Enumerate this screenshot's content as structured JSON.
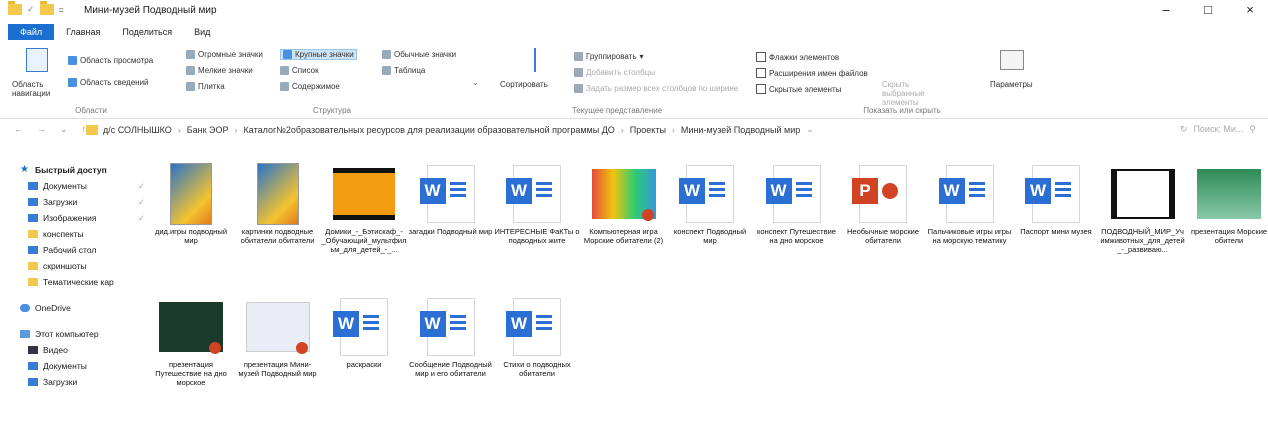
{
  "title": "Мини-музей Подводный мир",
  "window_controls": [
    "–",
    "□",
    "×"
  ],
  "tabs": [
    "Файл",
    "Главная",
    "Поделиться",
    "Вид"
  ],
  "ribbon": {
    "panes": {
      "nav_area": "Область навигации",
      "preview": "Область просмотра",
      "details": "Область сведений",
      "label": "Области"
    },
    "layout": {
      "huge": "Огромные значки",
      "large": "Крупные значки",
      "normal": "Обычные значки",
      "small": "Мелкие значки",
      "list": "Список",
      "table": "Таблица",
      "tiles": "Плитка",
      "content": "Содержимое",
      "label": "Структура"
    },
    "view": {
      "sort": "Сортировать",
      "group": "Группировать",
      "add_columns": "Добавить столбцы",
      "fit_columns": "Задать размер всех столбцов по ширине",
      "label": "Текущее представление"
    },
    "show": {
      "checkboxes": "Флажки элементов",
      "extensions": "Расширения имен файлов",
      "hidden": "Скрытые элементы",
      "hide_selected": "Скрыть выбранные элементы",
      "options": "Параметры",
      "label": "Показать или скрыть"
    }
  },
  "breadcrumbs": [
    "д/с СОЛНЫШКО",
    "Банк ЭОР",
    "Каталог№2образовательных ресурсов для реализации образовательной программы ДО",
    "Проекты",
    "Мини-музей Подводный мир"
  ],
  "search_placeholder": "Поиск: Ми...",
  "sidebar": [
    {
      "label": "Быстрый доступ",
      "icon": "star-icon"
    },
    {
      "label": "Документы",
      "icon": "documents-icon"
    },
    {
      "label": "Загрузки",
      "icon": "downloads-icon"
    },
    {
      "label": "Изображения",
      "icon": "pictures-icon"
    },
    {
      "label": "конспекты",
      "icon": "folder-icon"
    },
    {
      "label": "Рабочий стол",
      "icon": "desktop-icon"
    },
    {
      "label": "скриншоты",
      "icon": "folder-icon"
    },
    {
      "label": "Тематические кар",
      "icon": "folder-icon"
    },
    {
      "label": "OneDrive",
      "icon": "cloud-icon"
    },
    {
      "label": "Этот компьютер",
      "icon": "computer-icon"
    },
    {
      "label": "Видео",
      "icon": "video-folder-icon"
    },
    {
      "label": "Документы",
      "icon": "documents-icon"
    },
    {
      "label": "Загрузки",
      "icon": "downloads-icon"
    }
  ],
  "files": [
    {
      "name": "дид.игры подводный мир",
      "type": "folder-img"
    },
    {
      "name": "картинки подводные обитатели обитатели",
      "type": "folder-img"
    },
    {
      "name": "Домики_-_Бэтискаф_-_Обучающий_мультфильм_для_детей_-_...",
      "type": "video"
    },
    {
      "name": "загадки Подводный мир",
      "type": "word"
    },
    {
      "name": "ИНТЕРЕСНЫЕ ФаКТы о подводных жите",
      "type": "word"
    },
    {
      "name": "Компьютерная игра Морские обитатели (2)",
      "type": "pres1"
    },
    {
      "name": "конспект Подводный мир",
      "type": "word"
    },
    {
      "name": "конспект Путешествие на дно морское",
      "type": "word"
    },
    {
      "name": "Необычные морские обитатели",
      "type": "ppt"
    },
    {
      "name": "Пальчиковые игры игры на морскую тематику",
      "type": "word"
    },
    {
      "name": "Паспорт мини музея",
      "type": "word"
    },
    {
      "name": "ПОДВОДНЫЙ_МИР_Учимживотных_для_детей_-_развиваю...",
      "type": "video2"
    },
    {
      "name": "презентация Морские обители",
      "type": "pres3"
    },
    {
      "name": "презентация Путешествие на дно морское",
      "type": "pres2"
    },
    {
      "name": "презентация Мини-музей Подводный мир",
      "type": "pres4"
    },
    {
      "name": "раскраски",
      "type": "word"
    },
    {
      "name": "Сообщение Подводный мир и его обитатели",
      "type": "word"
    },
    {
      "name": "Стихи о подводных обитатели",
      "type": "word"
    }
  ]
}
